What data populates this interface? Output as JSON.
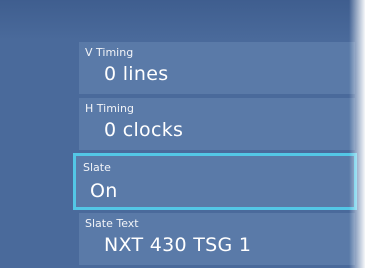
{
  "fields": [
    {
      "label": "V Timing",
      "value": "0 lines"
    },
    {
      "label": "H Timing",
      "value": "0 clocks"
    },
    {
      "label": "Slate",
      "value": "On"
    },
    {
      "label": "Slate Text",
      "value": "NXT 430 TSG 1"
    }
  ],
  "colors": {
    "background": "#4a6a9b",
    "field": "#5a7aa8",
    "focus_border": "#53c7e6"
  }
}
